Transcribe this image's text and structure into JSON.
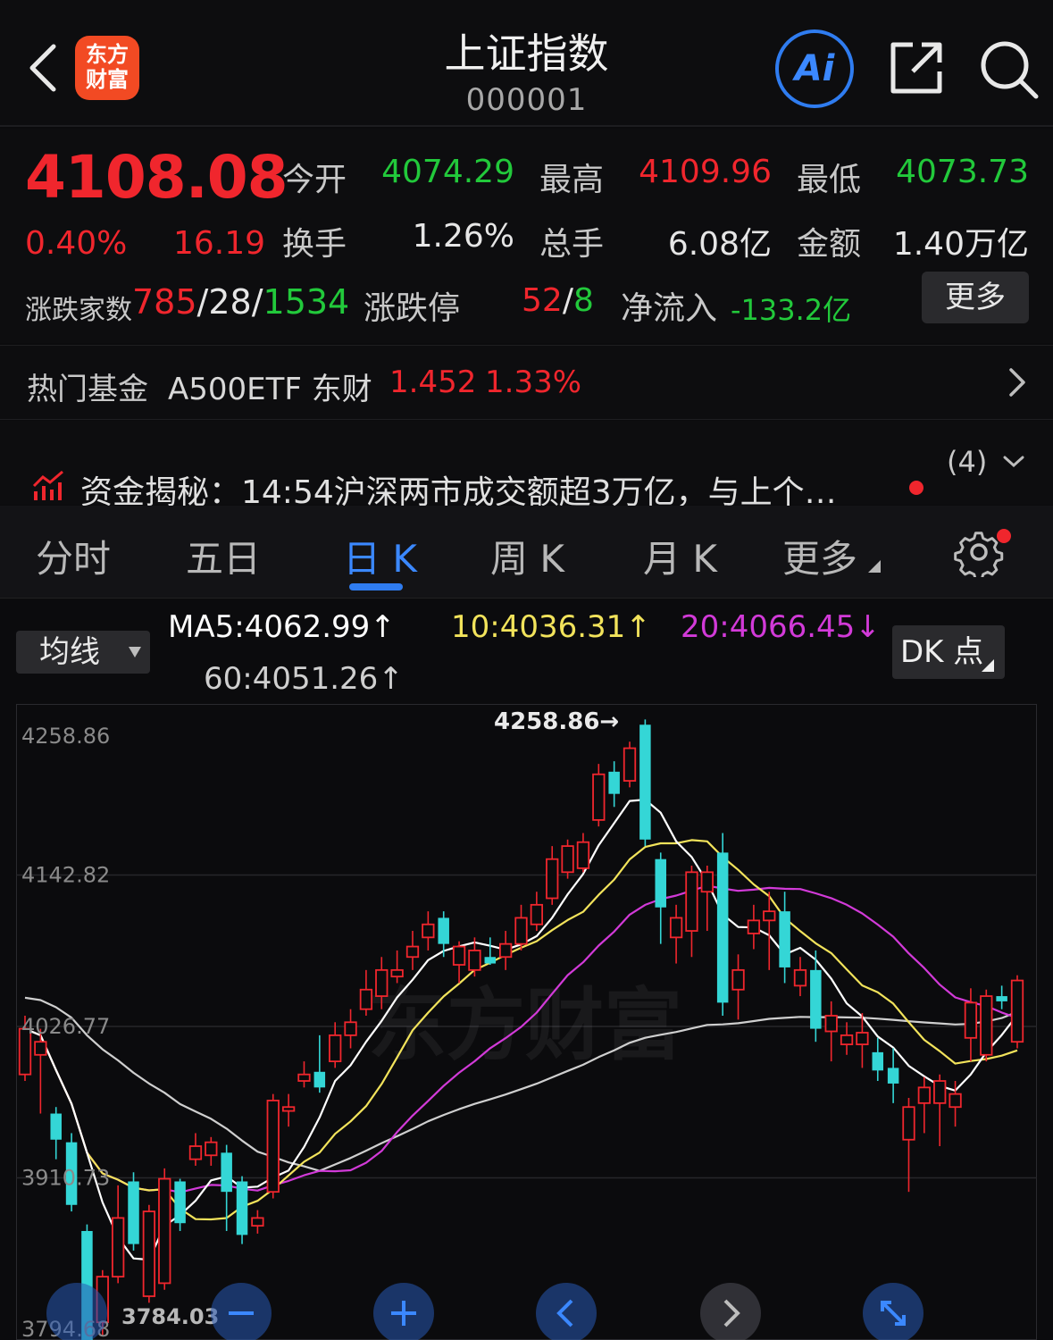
{
  "header": {
    "logo_line1": "东方",
    "logo_line2": "财富",
    "title": "上证指数",
    "code": "000001",
    "ai_label": "Ai"
  },
  "quote": {
    "last_price": "4108.08",
    "change_pct": "0.40%",
    "change_abs": "16.19",
    "fields": [
      {
        "label": "今开",
        "value": "4074.29",
        "color": "green"
      },
      {
        "label": "最高",
        "value": "4109.96",
        "color": "red"
      },
      {
        "label": "最低",
        "value": "4073.73",
        "color": "green"
      },
      {
        "label": "换手",
        "value": "1.26%",
        "color": "white"
      },
      {
        "label": "总手",
        "value": "6.08亿",
        "color": "white"
      },
      {
        "label": "金额",
        "value": "1.40万亿",
        "color": "white"
      }
    ],
    "breadth_label": "涨跌家数",
    "breadth_up": "785",
    "breadth_flat": "28",
    "breadth_down": "1534",
    "limit_label": "涨跌停",
    "limit_up": "52",
    "limit_down": "8",
    "netflow_label": "净流入",
    "netflow_value": "-133.2亿",
    "more_label": "更多"
  },
  "hot_fund": {
    "label": "热门基金",
    "name": "A500ETF 东财",
    "price": "1.452",
    "pct": "1.33%"
  },
  "news": {
    "text": "资金揭秘：14:54沪深两市成交额超3万亿，与上个…",
    "count": "(4)"
  },
  "tabs": [
    {
      "label": "分时"
    },
    {
      "label": "五日"
    },
    {
      "label": "日 K"
    },
    {
      "label": "周 K"
    },
    {
      "label": "月 K"
    },
    {
      "label": "更多"
    }
  ],
  "indicators": {
    "selector_label": "均线",
    "ma5": "MA5:4062.99↑",
    "ma10": "10:4036.31↑",
    "ma20": "20:4066.45↓",
    "ma60": "60:4051.26↑",
    "dk_label": "DK 点",
    "colors": {
      "ma5": "#ffffff",
      "ma10": "#f2e35b",
      "ma20": "#d23ad8",
      "ma60": "#cfcfcf"
    }
  },
  "chart_data": {
    "type": "candlestick",
    "y_ticks": [
      "4258.86",
      "4142.82",
      "4026.77",
      "3910.73",
      "3794.68"
    ],
    "ylim": [
      3794.68,
      4258.86
    ],
    "max_label": "4258.86→",
    "min_label": "3784.03",
    "watermark": "东方财富",
    "candles": [
      {
        "o": 3990,
        "c": 4025,
        "h": 4035,
        "l": 3985
      },
      {
        "o": 4005,
        "c": 4015,
        "h": 4025,
        "l": 3960
      },
      {
        "o": 3960,
        "c": 3940,
        "h": 3965,
        "l": 3925
      },
      {
        "o": 3938,
        "c": 3890,
        "h": 3945,
        "l": 3885
      },
      {
        "o": 3870,
        "c": 3780,
        "h": 3875,
        "l": 3775
      },
      {
        "o": 3800,
        "c": 3835,
        "h": 3840,
        "l": 3790
      },
      {
        "o": 3835,
        "c": 3880,
        "h": 3905,
        "l": 3830
      },
      {
        "o": 3908,
        "c": 3860,
        "h": 3915,
        "l": 3855
      },
      {
        "o": 3820,
        "c": 3885,
        "h": 3890,
        "l": 3815
      },
      {
        "o": 3830,
        "c": 3910,
        "h": 3918,
        "l": 3825
      },
      {
        "o": 3908,
        "c": 3876,
        "h": 3910,
        "l": 3870
      },
      {
        "o": 3925,
        "c": 3935,
        "h": 3945,
        "l": 3920
      },
      {
        "o": 3928,
        "c": 3938,
        "h": 3942,
        "l": 3920
      },
      {
        "o": 3930,
        "c": 3900,
        "h": 3936,
        "l": 3870
      },
      {
        "o": 3908,
        "c": 3867,
        "h": 3912,
        "l": 3860
      },
      {
        "o": 3874,
        "c": 3880,
        "h": 3886,
        "l": 3868
      },
      {
        "o": 3900,
        "c": 3970,
        "h": 3975,
        "l": 3895
      },
      {
        "o": 3962,
        "c": 3965,
        "h": 3975,
        "l": 3950
      },
      {
        "o": 3985,
        "c": 3990,
        "h": 4000,
        "l": 3980
      },
      {
        "o": 3992,
        "c": 3980,
        "h": 4020,
        "l": 3976
      },
      {
        "o": 4000,
        "c": 4020,
        "h": 4030,
        "l": 3995
      },
      {
        "o": 4020,
        "c": 4030,
        "h": 4040,
        "l": 4010
      },
      {
        "o": 4040,
        "c": 4055,
        "h": 4070,
        "l": 4035
      },
      {
        "o": 4050,
        "c": 4070,
        "h": 4080,
        "l": 4040
      },
      {
        "o": 4065,
        "c": 4070,
        "h": 4085,
        "l": 4060
      },
      {
        "o": 4080,
        "c": 4088,
        "h": 4100,
        "l": 4070
      },
      {
        "o": 4095,
        "c": 4105,
        "h": 4115,
        "l": 4085
      },
      {
        "o": 4110,
        "c": 4090,
        "h": 4115,
        "l": 4080
      },
      {
        "o": 4074,
        "c": 4088,
        "h": 4092,
        "l": 4060
      },
      {
        "o": 4070,
        "c": 4085,
        "h": 4095,
        "l": 4065
      },
      {
        "o": 4080,
        "c": 4075,
        "h": 4095,
        "l": 4074
      },
      {
        "o": 4080,
        "c": 4090,
        "h": 4100,
        "l": 4070
      },
      {
        "o": 4090,
        "c": 4110,
        "h": 4120,
        "l": 4085
      },
      {
        "o": 4105,
        "c": 4120,
        "h": 4130,
        "l": 4100
      },
      {
        "o": 4125,
        "c": 4155,
        "h": 4165,
        "l": 4120
      },
      {
        "o": 4145,
        "c": 4165,
        "h": 4170,
        "l": 4140
      },
      {
        "o": 4148,
        "c": 4168,
        "h": 4175,
        "l": 4145
      },
      {
        "o": 4185,
        "c": 4220,
        "h": 4228,
        "l": 4180
      },
      {
        "o": 4222,
        "c": 4205,
        "h": 4230,
        "l": 4195
      },
      {
        "o": 4215,
        "c": 4240,
        "h": 4245,
        "l": 4210
      },
      {
        "o": 4258,
        "c": 4170,
        "h": 4262,
        "l": 4165
      },
      {
        "o": 4155,
        "c": 4118,
        "h": 4160,
        "l": 4090
      },
      {
        "o": 4095,
        "c": 4110,
        "h": 4120,
        "l": 4075
      },
      {
        "o": 4100,
        "c": 4145,
        "h": 4150,
        "l": 4080
      },
      {
        "o": 4130,
        "c": 4145,
        "h": 4150,
        "l": 4100
      },
      {
        "o": 4160,
        "c": 4045,
        "h": 4175,
        "l": 4035
      },
      {
        "o": 4055,
        "c": 4070,
        "h": 4082,
        "l": 4032
      },
      {
        "o": 4098,
        "c": 4108,
        "h": 4120,
        "l": 4086
      },
      {
        "o": 4108,
        "c": 4115,
        "h": 4130,
        "l": 4070
      },
      {
        "o": 4115,
        "c": 4072,
        "h": 4130,
        "l": 4060
      },
      {
        "o": 4058,
        "c": 4070,
        "h": 4080,
        "l": 4050
      },
      {
        "o": 4070,
        "c": 4025,
        "h": 4085,
        "l": 4015
      },
      {
        "o": 4023,
        "c": 4035,
        "h": 4046,
        "l": 4000
      },
      {
        "o": 4013,
        "c": 4020,
        "h": 4030,
        "l": 4005
      },
      {
        "o": 4013,
        "c": 4022,
        "h": 4037,
        "l": 3995
      },
      {
        "o": 4007,
        "c": 3993,
        "h": 4018,
        "l": 3985
      },
      {
        "o": 3995,
        "c": 3983,
        "h": 4010,
        "l": 3968
      },
      {
        "o": 3940,
        "c": 3965,
        "h": 3972,
        "l": 3900
      },
      {
        "o": 3968,
        "c": 3980,
        "h": 3988,
        "l": 3945
      },
      {
        "o": 3968,
        "c": 3985,
        "h": 3990,
        "l": 3935
      },
      {
        "o": 3965,
        "c": 3975,
        "h": 3985,
        "l": 3950
      },
      {
        "o": 4018,
        "c": 4045,
        "h": 4056,
        "l": 4000
      },
      {
        "o": 4005,
        "c": 4050,
        "h": 4055,
        "l": 4000
      },
      {
        "o": 4050,
        "c": 4046,
        "h": 4058,
        "l": 4040
      },
      {
        "o": 4015,
        "c": 4062,
        "h": 4066,
        "l": 4010
      }
    ]
  },
  "nav_buttons": [
    "zoom-out",
    "zoom-in",
    "prev",
    "next",
    "fullscreen"
  ]
}
